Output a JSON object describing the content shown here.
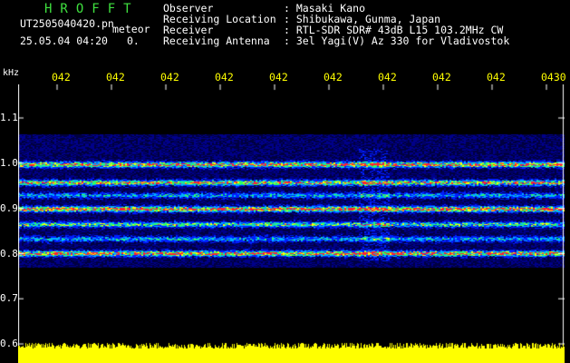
{
  "header": {
    "program_title": "HROFFT",
    "filename": "UT2505040420.pn",
    "suffix": "meteor",
    "datetime": "25.05.04 04:20",
    "count": "0."
  },
  "meta": [
    {
      "key": "Observer",
      "value": ": Masaki Kano"
    },
    {
      "key": "Receiving Location",
      "value": ": Shibukawa, Gunma, Japan"
    },
    {
      "key": "Receiver",
      "value": ": RTL-SDR SDR# 43dB L15 103.2MHz CW"
    },
    {
      "key": "Receiving Antenna",
      "value": ": 3el Yagi(V) Az 330 for Vladivostok"
    }
  ],
  "axis": {
    "unit": "kHz",
    "y_ticks": [
      "1.1",
      "1.0",
      "0.9",
      "0.8",
      "0.7",
      "0.6"
    ],
    "x_ticks": [
      "042",
      "042",
      "042",
      "042",
      "042",
      "042",
      "042",
      "042",
      "042",
      "0430"
    ]
  },
  "colors": {
    "title": "#3fe03f",
    "x_ticks": "#ffff00",
    "footer": "#ffff00"
  }
}
